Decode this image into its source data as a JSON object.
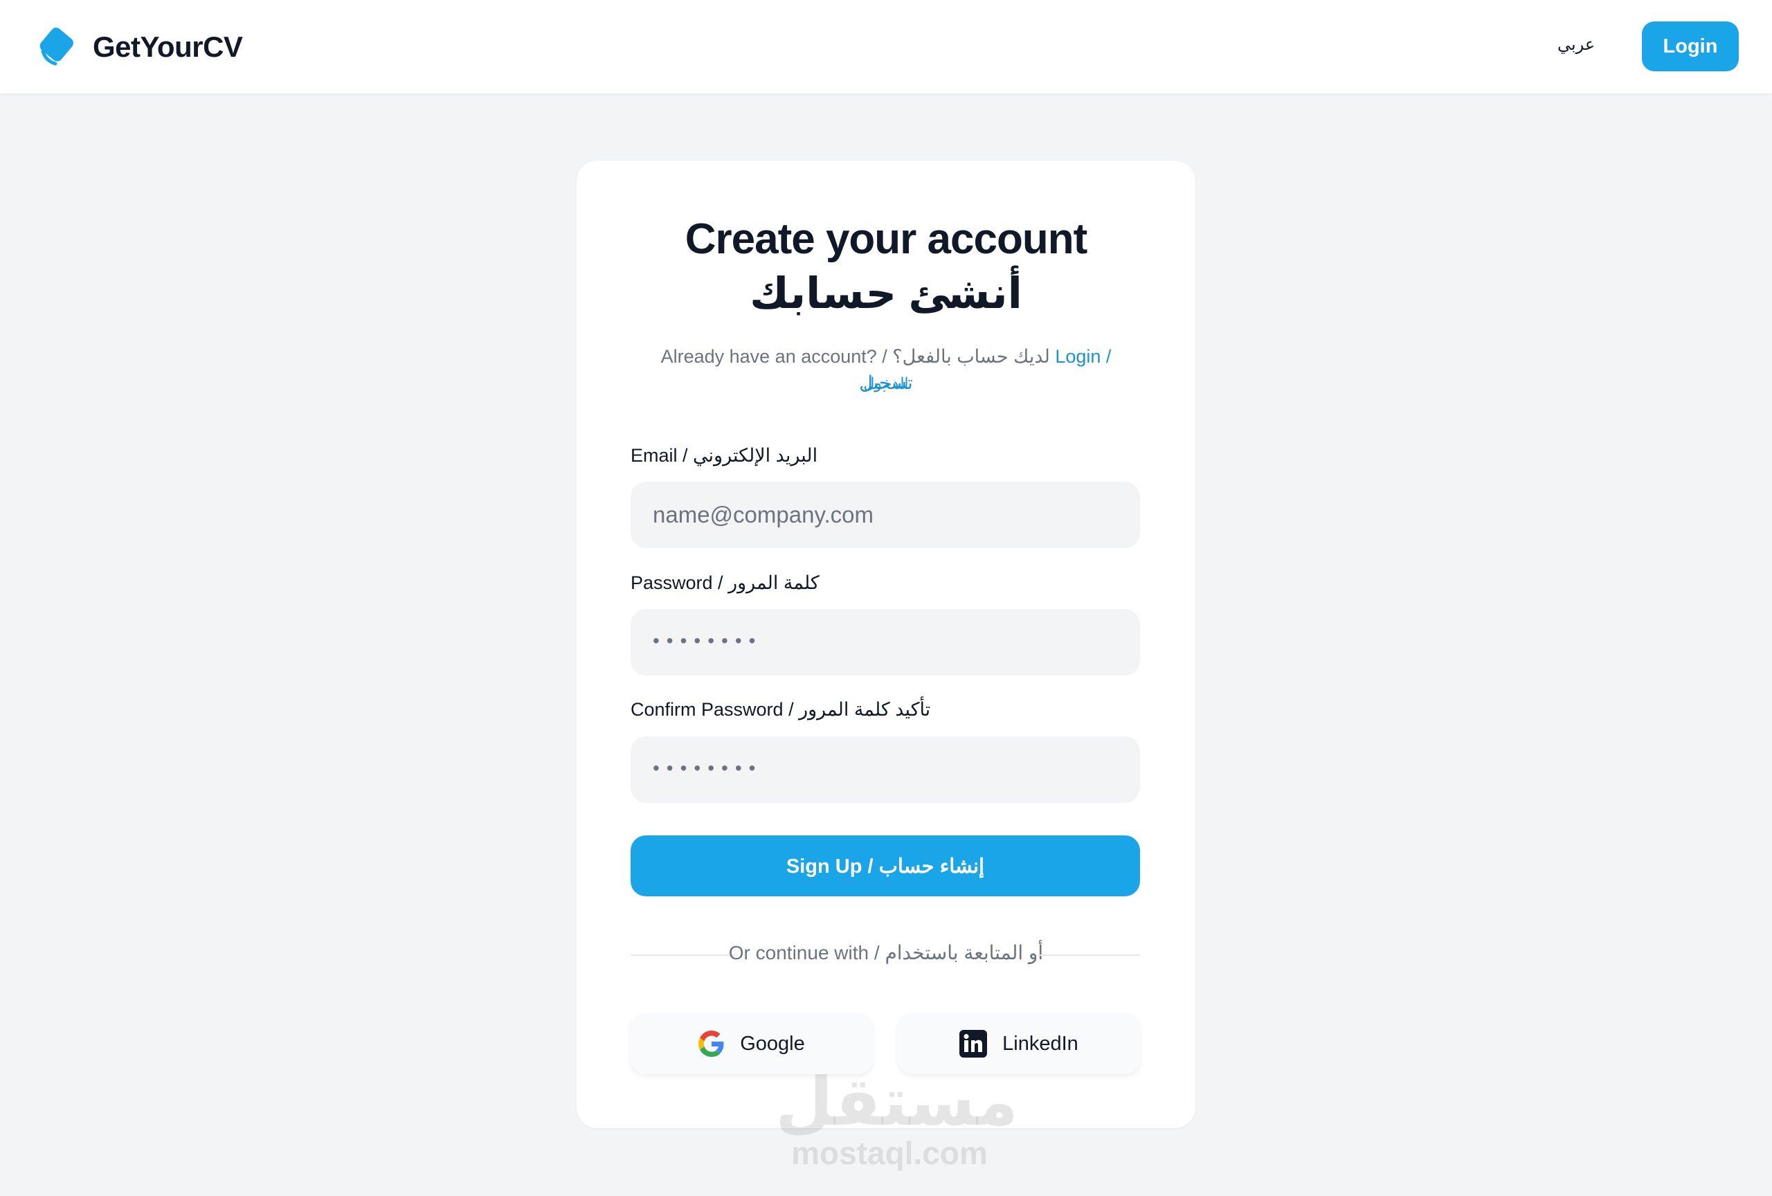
{
  "brand": {
    "name": "GetYourCV",
    "accent": "#1aa5e8"
  },
  "header": {
    "language_toggle": "عربي",
    "login_label": "Login"
  },
  "card": {
    "title_en": "Create your account",
    "title_ar": "أنشئ حسابك",
    "already_text": "Already have an account? / لديك حساب بالفعل؟",
    "login_link": "Login / تسجيل",
    "login_link_cont": "الدخول"
  },
  "form": {
    "email_label": "Email / البريد الإلكتروني",
    "email_placeholder": "name@company.com",
    "password_label": "Password / كلمة المرور",
    "password_mask": "••••••••",
    "confirm_label": "Confirm Password / تأكيد كلمة المرور",
    "confirm_mask": "••••••••",
    "submit_label": "Sign Up / إنشاء حساب"
  },
  "social": {
    "divider_text": "Or continue with / أو المتابعة باستخدام",
    "google_label": "Google",
    "linkedin_label": "LinkedIn"
  },
  "watermark": {
    "ar": "مستقل",
    "en": "mostaql.com"
  }
}
